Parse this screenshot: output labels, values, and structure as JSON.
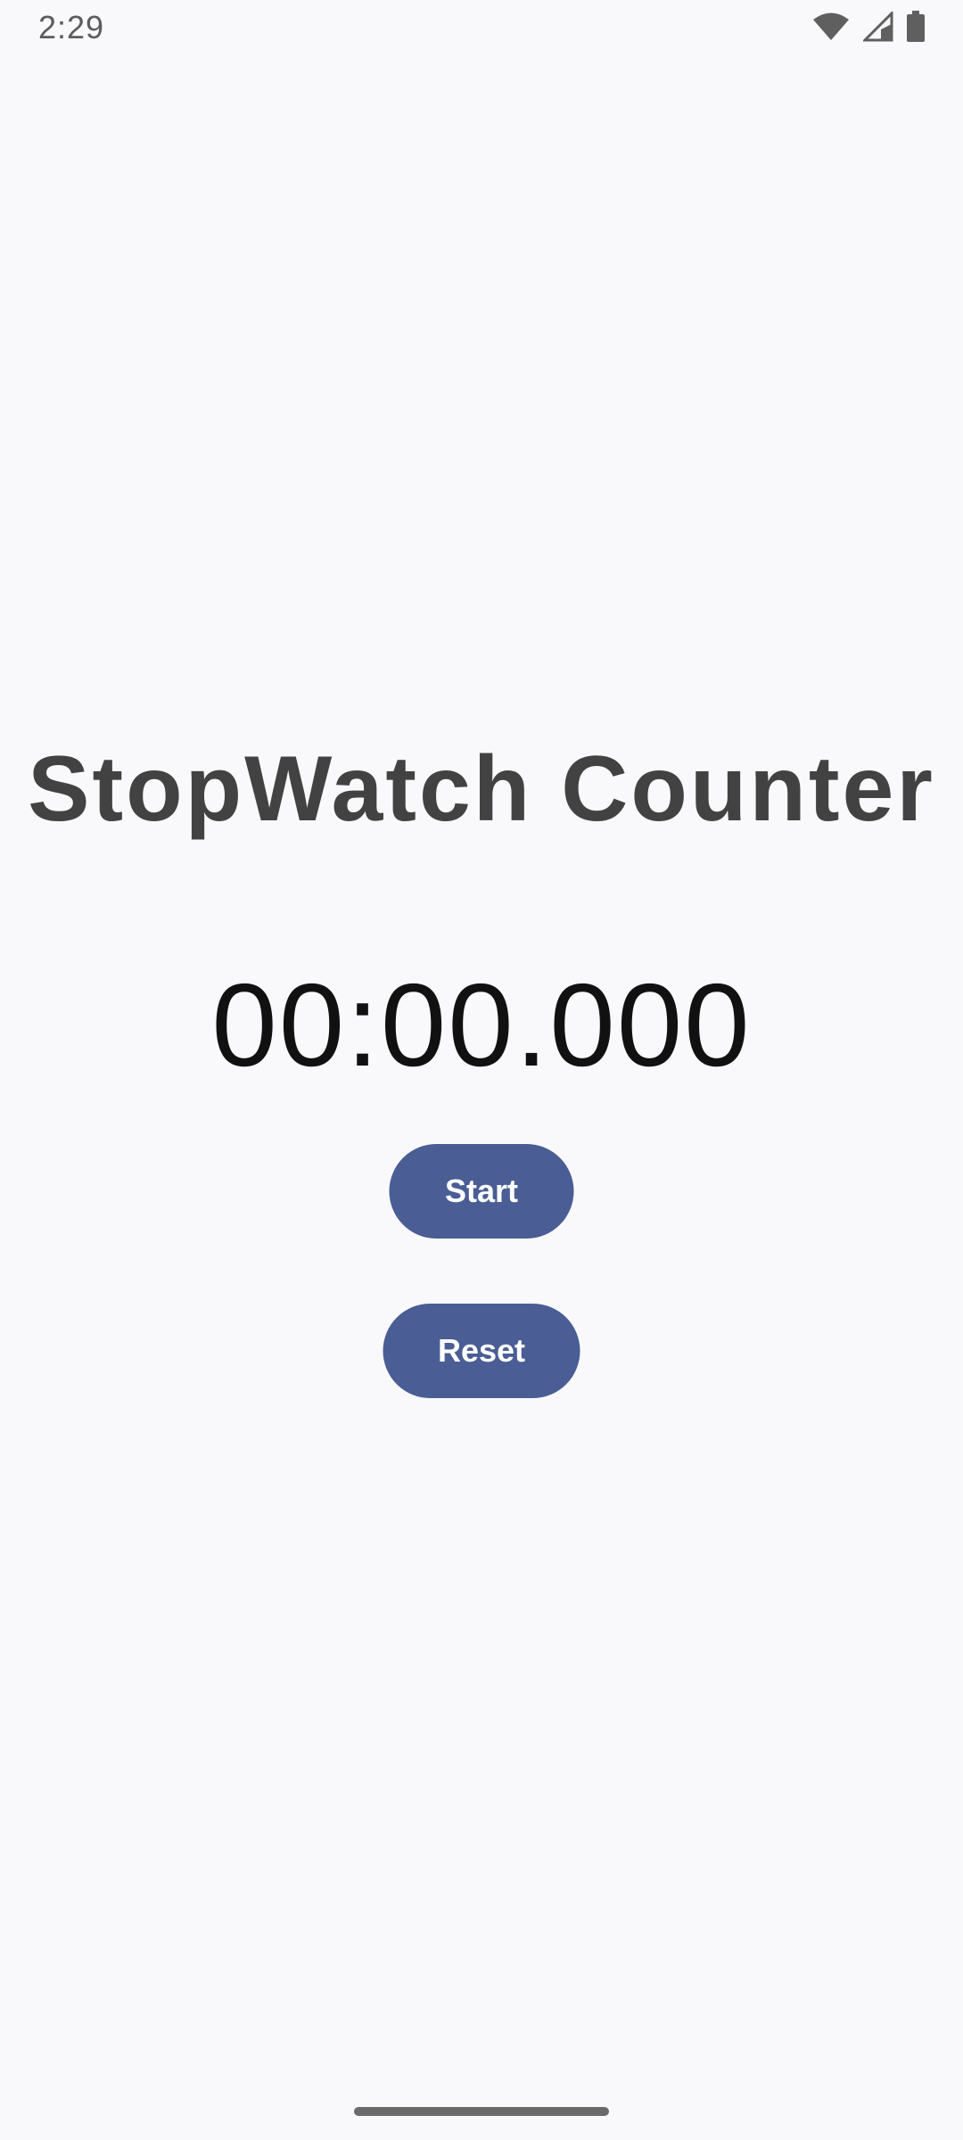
{
  "status_bar": {
    "time": "2:29",
    "icons": [
      "wifi-icon",
      "cellular-signal-icon",
      "battery-icon"
    ]
  },
  "main": {
    "title": "StopWatch Counter",
    "timer_display": "00:00.000",
    "start_label": "Start",
    "reset_label": "Reset"
  },
  "colors": {
    "background": "#f9f9fb",
    "button": "#4a5d94",
    "title_text": "#424242",
    "timer_text": "#111111"
  }
}
